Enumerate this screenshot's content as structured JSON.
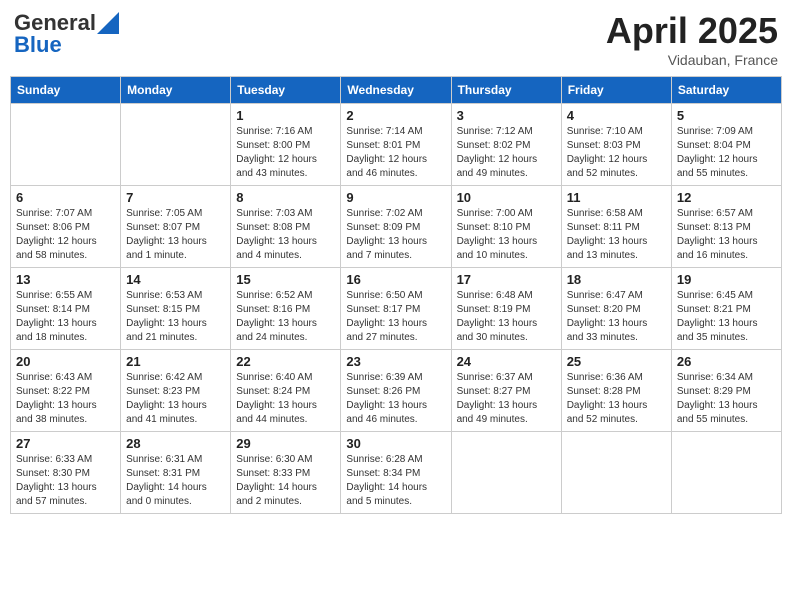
{
  "header": {
    "logo_general": "General",
    "logo_blue": "Blue",
    "month_title": "April 2025",
    "location": "Vidauban, France"
  },
  "days_of_week": [
    "Sunday",
    "Monday",
    "Tuesday",
    "Wednesday",
    "Thursday",
    "Friday",
    "Saturday"
  ],
  "weeks": [
    [
      {
        "day": "",
        "info": ""
      },
      {
        "day": "",
        "info": ""
      },
      {
        "day": "1",
        "info": "Sunrise: 7:16 AM\nSunset: 8:00 PM\nDaylight: 12 hours and 43 minutes."
      },
      {
        "day": "2",
        "info": "Sunrise: 7:14 AM\nSunset: 8:01 PM\nDaylight: 12 hours and 46 minutes."
      },
      {
        "day": "3",
        "info": "Sunrise: 7:12 AM\nSunset: 8:02 PM\nDaylight: 12 hours and 49 minutes."
      },
      {
        "day": "4",
        "info": "Sunrise: 7:10 AM\nSunset: 8:03 PM\nDaylight: 12 hours and 52 minutes."
      },
      {
        "day": "5",
        "info": "Sunrise: 7:09 AM\nSunset: 8:04 PM\nDaylight: 12 hours and 55 minutes."
      }
    ],
    [
      {
        "day": "6",
        "info": "Sunrise: 7:07 AM\nSunset: 8:06 PM\nDaylight: 12 hours and 58 minutes."
      },
      {
        "day": "7",
        "info": "Sunrise: 7:05 AM\nSunset: 8:07 PM\nDaylight: 13 hours and 1 minute."
      },
      {
        "day": "8",
        "info": "Sunrise: 7:03 AM\nSunset: 8:08 PM\nDaylight: 13 hours and 4 minutes."
      },
      {
        "day": "9",
        "info": "Sunrise: 7:02 AM\nSunset: 8:09 PM\nDaylight: 13 hours and 7 minutes."
      },
      {
        "day": "10",
        "info": "Sunrise: 7:00 AM\nSunset: 8:10 PM\nDaylight: 13 hours and 10 minutes."
      },
      {
        "day": "11",
        "info": "Sunrise: 6:58 AM\nSunset: 8:11 PM\nDaylight: 13 hours and 13 minutes."
      },
      {
        "day": "12",
        "info": "Sunrise: 6:57 AM\nSunset: 8:13 PM\nDaylight: 13 hours and 16 minutes."
      }
    ],
    [
      {
        "day": "13",
        "info": "Sunrise: 6:55 AM\nSunset: 8:14 PM\nDaylight: 13 hours and 18 minutes."
      },
      {
        "day": "14",
        "info": "Sunrise: 6:53 AM\nSunset: 8:15 PM\nDaylight: 13 hours and 21 minutes."
      },
      {
        "day": "15",
        "info": "Sunrise: 6:52 AM\nSunset: 8:16 PM\nDaylight: 13 hours and 24 minutes."
      },
      {
        "day": "16",
        "info": "Sunrise: 6:50 AM\nSunset: 8:17 PM\nDaylight: 13 hours and 27 minutes."
      },
      {
        "day": "17",
        "info": "Sunrise: 6:48 AM\nSunset: 8:19 PM\nDaylight: 13 hours and 30 minutes."
      },
      {
        "day": "18",
        "info": "Sunrise: 6:47 AM\nSunset: 8:20 PM\nDaylight: 13 hours and 33 minutes."
      },
      {
        "day": "19",
        "info": "Sunrise: 6:45 AM\nSunset: 8:21 PM\nDaylight: 13 hours and 35 minutes."
      }
    ],
    [
      {
        "day": "20",
        "info": "Sunrise: 6:43 AM\nSunset: 8:22 PM\nDaylight: 13 hours and 38 minutes."
      },
      {
        "day": "21",
        "info": "Sunrise: 6:42 AM\nSunset: 8:23 PM\nDaylight: 13 hours and 41 minutes."
      },
      {
        "day": "22",
        "info": "Sunrise: 6:40 AM\nSunset: 8:24 PM\nDaylight: 13 hours and 44 minutes."
      },
      {
        "day": "23",
        "info": "Sunrise: 6:39 AM\nSunset: 8:26 PM\nDaylight: 13 hours and 46 minutes."
      },
      {
        "day": "24",
        "info": "Sunrise: 6:37 AM\nSunset: 8:27 PM\nDaylight: 13 hours and 49 minutes."
      },
      {
        "day": "25",
        "info": "Sunrise: 6:36 AM\nSunset: 8:28 PM\nDaylight: 13 hours and 52 minutes."
      },
      {
        "day": "26",
        "info": "Sunrise: 6:34 AM\nSunset: 8:29 PM\nDaylight: 13 hours and 55 minutes."
      }
    ],
    [
      {
        "day": "27",
        "info": "Sunrise: 6:33 AM\nSunset: 8:30 PM\nDaylight: 13 hours and 57 minutes."
      },
      {
        "day": "28",
        "info": "Sunrise: 6:31 AM\nSunset: 8:31 PM\nDaylight: 14 hours and 0 minutes."
      },
      {
        "day": "29",
        "info": "Sunrise: 6:30 AM\nSunset: 8:33 PM\nDaylight: 14 hours and 2 minutes."
      },
      {
        "day": "30",
        "info": "Sunrise: 6:28 AM\nSunset: 8:34 PM\nDaylight: 14 hours and 5 minutes."
      },
      {
        "day": "",
        "info": ""
      },
      {
        "day": "",
        "info": ""
      },
      {
        "day": "",
        "info": ""
      }
    ]
  ]
}
